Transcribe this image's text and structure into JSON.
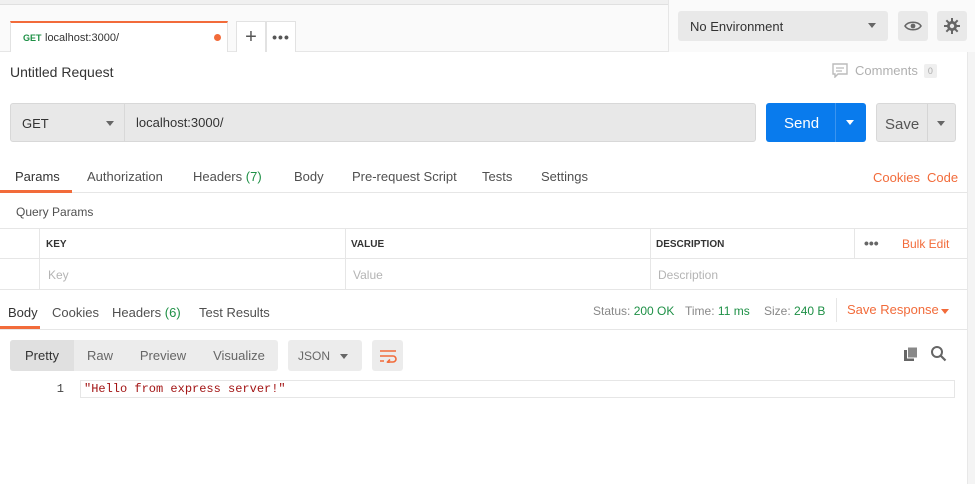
{
  "tab": {
    "method": "GET",
    "url": "localhost:3000/",
    "add_label": "+",
    "more_label": "•••"
  },
  "environment": {
    "selected": "No Environment"
  },
  "request": {
    "title": "Untitled Request",
    "comments_label": "Comments",
    "comments_count": "0",
    "method": "GET",
    "url": "localhost:3000/",
    "send_label": "Send",
    "save_label": "Save"
  },
  "request_tabs": [
    {
      "label": "Params",
      "count": ""
    },
    {
      "label": "Authorization",
      "count": ""
    },
    {
      "label": "Headers",
      "count": "(7)"
    },
    {
      "label": "Body",
      "count": ""
    },
    {
      "label": "Pre-request Script",
      "count": ""
    },
    {
      "label": "Tests",
      "count": ""
    },
    {
      "label": "Settings",
      "count": ""
    }
  ],
  "request_links": {
    "cookies": "Cookies",
    "code": "Code"
  },
  "query_params": {
    "label": "Query Params",
    "headers": {
      "key": "KEY",
      "value": "VALUE",
      "description": "DESCRIPTION"
    },
    "more": "•••",
    "bulk_edit": "Bulk Edit",
    "placeholders": {
      "key": "Key",
      "value": "Value",
      "description": "Description"
    }
  },
  "response_tabs": [
    {
      "label": "Body",
      "count": ""
    },
    {
      "label": "Cookies",
      "count": ""
    },
    {
      "label": "Headers",
      "count": "(6)"
    },
    {
      "label": "Test Results",
      "count": ""
    }
  ],
  "response_status": {
    "status_label": "Status:",
    "status_value": "200 OK",
    "time_label": "Time:",
    "time_value": "11 ms",
    "size_label": "Size:",
    "size_value": "240 B",
    "save_response": "Save Response"
  },
  "format_bar": {
    "modes": [
      "Pretty",
      "Raw",
      "Preview",
      "Visualize"
    ],
    "language": "JSON"
  },
  "response_body": {
    "line_number": "1",
    "content": "\"Hello from express server!\""
  },
  "colors": {
    "accent": "#f26b3a",
    "send": "#097bed",
    "success": "#1e9046"
  }
}
